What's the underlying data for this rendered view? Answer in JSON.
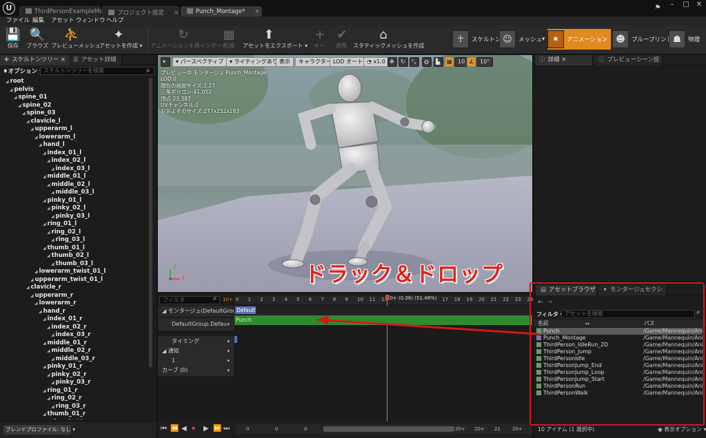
{
  "titlebar": {
    "tabs": [
      "ThirdPersonExampleMap",
      "プロジェクト設定",
      "Punch_Montage*"
    ]
  },
  "menubar": [
    "ファイル",
    "編集",
    "アセット",
    "ウィンドウ",
    "ヘルプ"
  ],
  "toolbar": {
    "buttons": [
      "保存",
      "ブラウズ",
      "プレビューメッシュ",
      "アセットを作成",
      "アニメーションを再インポート",
      "圧縮",
      "アセットをエクスポート",
      "キー",
      "適用",
      "スタティックメッシュを作成"
    ],
    "modes": [
      "スケルトン",
      "メッシュ",
      "アニメーション",
      "ブループリント",
      "物理"
    ]
  },
  "skeleton_panel": {
    "tabs": [
      "スケルトンツリー",
      "アセット詳細"
    ],
    "options_label": "オプション",
    "search_placeholder": "スケルトンツリーを検索",
    "bones": [
      "root",
      "pelvis",
      "spine_01",
      "spine_02",
      "spine_03",
      "clavicle_l",
      "upperarm_l",
      "lowerarm_l",
      "hand_l",
      "index_01_l",
      "index_02_l",
      "index_03_l",
      "middle_01_l",
      "middle_02_l",
      "middle_03_l",
      "pinky_01_l",
      "pinky_02_l",
      "pinky_03_l",
      "ring_01_l",
      "ring_02_l",
      "ring_03_l",
      "thumb_01_l",
      "thumb_02_l",
      "thumb_03_l",
      "lowerarm_twist_01_l",
      "upperarm_twist_01_l",
      "clavicle_r",
      "upperarm_r",
      "lowerarm_r",
      "hand_r",
      "index_01_r",
      "index_02_r",
      "index_03_r",
      "middle_01_r",
      "middle_02_r",
      "middle_03_r",
      "pinky_01_r",
      "pinky_02_r",
      "pinky_03_r",
      "ring_01_r",
      "ring_02_r",
      "ring_03_r",
      "thumb_01_r",
      "thumb_02_r",
      "thumb_03_r"
    ],
    "blend_profile": "ブレンドプロファイル: なし"
  },
  "viewport": {
    "toolbar": {
      "perspective": "パースペクティブ",
      "lighting": "ライティングあり",
      "show": "表示",
      "character": "キャラクター",
      "lod": "LOD オート",
      "speed": "x1.0",
      "grid_snap": "10",
      "rot_snap": "10°"
    },
    "info_lines": [
      "プレビュー中 モンタージュ Punch_Montage",
      "LOD:0",
      "現在の画面サイズ:2.27",
      "三角ポリゴン:41,052",
      "頂点:23,387",
      "UVチャンネル:1",
      "おおよそのサイズ:277x252x283"
    ]
  },
  "overlay_text": "ドラック＆ドロップ",
  "timeline": {
    "filter_placeholder": "フィルタ",
    "playhead_label": "10+ (0.36) (51.48%)",
    "rows": [
      "モンタージュ(DefaultGroup",
      "DefaultGroup.Defau",
      "タイミング",
      "通知",
      "1",
      "カーブ (0)"
    ],
    "section_label": "Default",
    "slot_clip": "Punch",
    "ruler": [
      "0",
      "1",
      "2",
      "3",
      "4",
      "5",
      "6",
      "7",
      "8",
      "9",
      "10",
      "11",
      "12",
      "13",
      "14",
      "15",
      "16",
      "17",
      "18",
      "19",
      "20",
      "21",
      "22",
      "23",
      "24"
    ],
    "transport_numbers": [
      "0",
      "0",
      "0",
      "20+",
      "20+",
      "21",
      "20+"
    ]
  },
  "details_panel": {
    "tabs": [
      "詳細",
      "プレビューシーン設"
    ]
  },
  "asset_browser": {
    "tabs": [
      "アセットブラウザ",
      "モンタージュセクシ"
    ],
    "filter_label": "フィルタ",
    "search_placeholder": "アセットを検索",
    "col_name": "名前",
    "col_path": "パス",
    "items": [
      {
        "name": "Punch",
        "path": "/Game/Mannequin/Ani"
      },
      {
        "name": "Punch_Montage",
        "path": "/Game/Mannequin/Ani"
      },
      {
        "name": "ThirdPerson_IdleRun_2D",
        "path": "/Game/Mannequin/Ani"
      },
      {
        "name": "ThirdPerson_Jump",
        "path": "/Game/Mannequin/Ani"
      },
      {
        "name": "ThirdPersonIdle",
        "path": "/Game/Mannequin/Ani"
      },
      {
        "name": "ThirdPersonJump_End",
        "path": "/Game/Mannequin/Ani"
      },
      {
        "name": "ThirdPersonJump_Loop",
        "path": "/Game/Mannequin/Ani"
      },
      {
        "name": "ThirdPersonJump_Start",
        "path": "/Game/Mannequin/Ani"
      },
      {
        "name": "ThirdPersonRun",
        "path": "/Game/Mannequin/Ani"
      },
      {
        "name": "ThirdPersonWalk",
        "path": "/Game/Mannequin/Ani"
      }
    ],
    "status": "10 アイテム (1 選択中)",
    "view_options": "表示オプション"
  },
  "colors": {
    "accent": "#e08a20",
    "annotation_red": "#d31818",
    "slot_green": "#2e8b2e",
    "section_blue": "#5e6fb8"
  }
}
